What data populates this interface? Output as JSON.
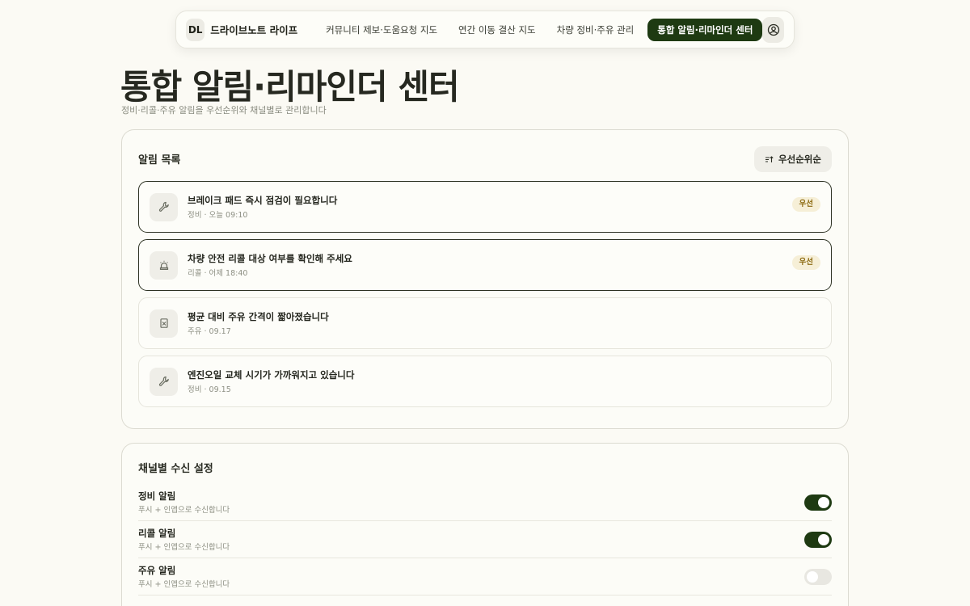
{
  "nav": {
    "logo": "DL",
    "brand": "드라이브노트 라이프",
    "links": [
      {
        "label": "커뮤니티 제보·도움요청 지도",
        "active": false
      },
      {
        "label": "연간 이동 결산 지도",
        "active": false
      },
      {
        "label": "차량 정비·주유 관리",
        "active": false
      },
      {
        "label": "통합 알림·리마인더 센터",
        "active": true
      }
    ],
    "user_icon": "user-circle-icon"
  },
  "header": {
    "title": "통합 알림·리마인더 센터",
    "subtitle": "정비·리콜·주유 알림을 우선순위와 채널별로 관리합니다"
  },
  "alerts": {
    "title": "알림 목록",
    "sort_label": "우선순위순",
    "sort_icon": "sort-icon",
    "items": [
      {
        "icon": "wrench-icon",
        "title": "브레이크 패드 즉시 점검이 필요합니다",
        "meta": "정비 · 오늘 09:10",
        "badge": "우선",
        "priority": true
      },
      {
        "icon": "siren-icon",
        "title": "차량 안전 리콜 대상 여부를 확인해 주세요",
        "meta": "리콜 · 어제 18:40",
        "badge": "우선",
        "priority": true
      },
      {
        "icon": "fuel-icon",
        "title": "평균 대비 주유 간격이 짧아졌습니다",
        "meta": "주유 · 09.17",
        "badge": "",
        "priority": false
      },
      {
        "icon": "wrench-icon",
        "title": "엔진오일 교체 시기가 가까워지고 있습니다",
        "meta": "정비 · 09.15",
        "badge": "",
        "priority": false
      }
    ]
  },
  "channels": {
    "title": "채널별 수신 설정",
    "items": [
      {
        "label": "정비 알림",
        "desc": "푸시 + 인앱으로 수신합니다",
        "enabled": true
      },
      {
        "label": "리콜 알림",
        "desc": "푸시 + 인앱으로 수신합니다",
        "enabled": true
      },
      {
        "label": "주유 알림",
        "desc": "푸시 + 인앱으로 수신합니다",
        "enabled": false
      }
    ]
  },
  "colors": {
    "accent": "#1e3a12",
    "badge_bg": "#f6efd7",
    "badge_text": "#8d6b12",
    "background": "#fbfaf4"
  }
}
